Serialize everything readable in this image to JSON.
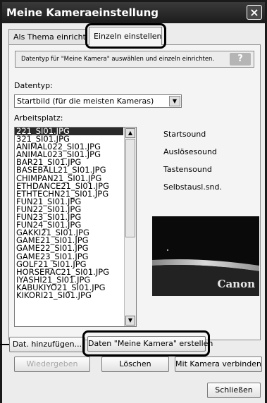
{
  "window": {
    "title": "Meine Kameraeinstellung",
    "close_icon": "×"
  },
  "tabs": [
    {
      "label": "Als Thema einrichten"
    },
    {
      "label": "Einzeln einstellen"
    }
  ],
  "info": {
    "text": "Datentyp für \"Meine Kamera\" auswählen und einzeln einrichten.",
    "help_label": "?"
  },
  "datatype": {
    "label": "Datentyp:",
    "value": "Startbild (für die meisten Kameras)"
  },
  "workspace": {
    "label": "Arbeitsplatz:"
  },
  "files": [
    "221_SI01.JPG",
    "321_SI01.JPG",
    "ANIMAL022_SI01.JPG",
    "ANIMAL023_SI01.JPG",
    "BAR21_SI01.JPG",
    "BASEBALL21_SI01.JPG",
    "CHIMPAN21_SI01.JPG",
    "ETHDANCE21_SI01.JPG",
    "ETHTECHN21_SI01.JPG",
    "FUN21_SI01.JPG",
    "FUN22_SI01.JPG",
    "FUN23_SI01.JPG",
    "FUN24_SI01.JPG",
    "GAKKI21_SI01.JPG",
    "GAME21_SI01.JPG",
    "GAME22_SI01.JPG",
    "GAME23_SI01.JPG",
    "GOLF21_SI01.JPG",
    "HORSERAC21_SI01.JPG",
    "IYASHI21_SI01.JPG",
    "KABUKIYO21_SI01.JPG",
    "KIKORI21_SI01.JPG"
  ],
  "sounds": [
    "Startsound",
    "Auslösesound",
    "Tastensound",
    "Selbstausl.snd."
  ],
  "preview": {
    "brand": "Canon"
  },
  "buttons": {
    "add": "Dat. hinzufügen...",
    "create": "Daten \"Meine Kamera\" erstellen",
    "play": "Wiedergeben",
    "delete": "Löschen",
    "connect": "Mit Kamera verbinden",
    "close": "Schließen"
  },
  "colors": {
    "titlebar": "#1c1c1c",
    "selection": "#2a2a2a",
    "preview_bg": "#0a0a0a"
  }
}
